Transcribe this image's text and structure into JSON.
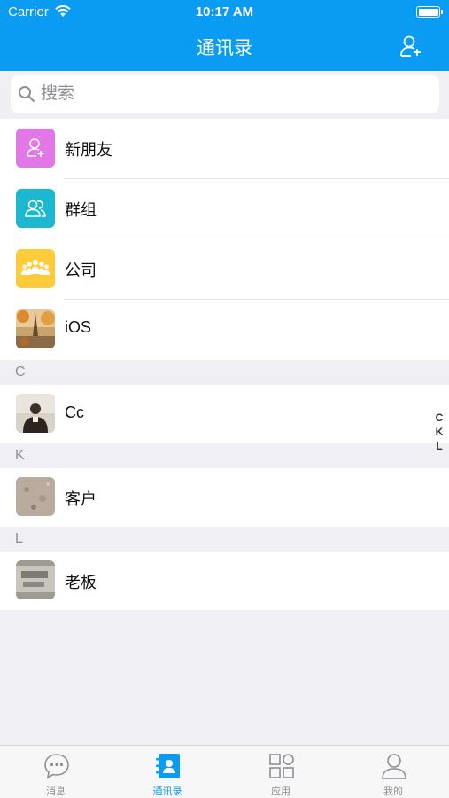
{
  "status_bar": {
    "carrier": "Carrier",
    "time": "10:17 AM"
  },
  "nav": {
    "title": "通讯录",
    "right_icon": "add-contact-icon"
  },
  "search": {
    "placeholder": "搜索"
  },
  "quick_items": [
    {
      "label": "新朋友",
      "icon": "new-friend-icon",
      "color": "#e277e8"
    },
    {
      "label": "群组",
      "icon": "group-icon",
      "color": "#1cb8cf"
    },
    {
      "label": "公司",
      "icon": "company-icon",
      "color": "#fecb3a"
    },
    {
      "label": "iOS",
      "icon": "photo-avatar"
    }
  ],
  "sections": [
    {
      "letter": "C",
      "contacts": [
        {
          "name": "Cc"
        }
      ]
    },
    {
      "letter": "K",
      "contacts": [
        {
          "name": "客户"
        }
      ]
    },
    {
      "letter": "L",
      "contacts": [
        {
          "name": "老板"
        }
      ]
    }
  ],
  "index_bar": [
    "C",
    "K",
    "L"
  ],
  "tabbar": {
    "tabs": [
      {
        "label": "消息",
        "icon": "chat-bubble-icon",
        "active": false
      },
      {
        "label": "通讯录",
        "icon": "contacts-book-icon",
        "active": true
      },
      {
        "label": "应用",
        "icon": "apps-grid-icon",
        "active": false
      },
      {
        "label": "我的",
        "icon": "profile-icon",
        "active": false
      }
    ]
  },
  "colors": {
    "accent": "#0a9bf2",
    "background": "#efeff4"
  }
}
